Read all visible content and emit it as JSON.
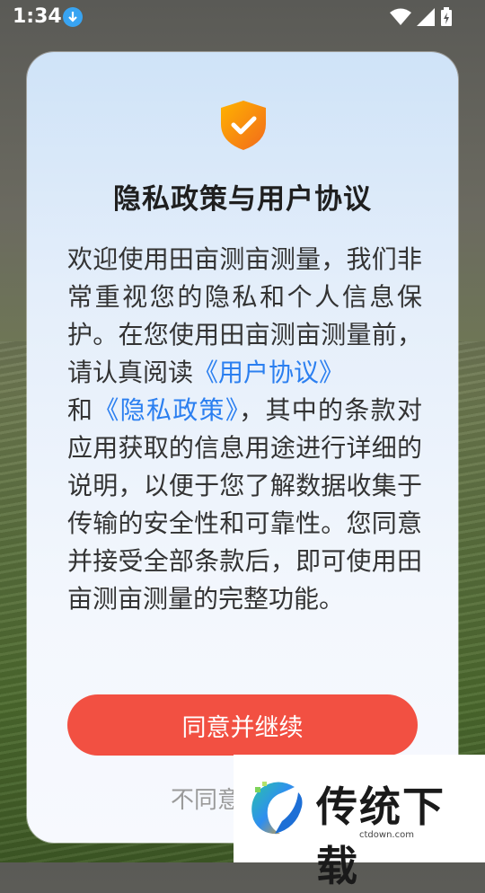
{
  "status_bar": {
    "time": "1:34",
    "download_icon": "download-arrow-icon",
    "wifi_icon": "wifi-icon",
    "signal_icon": "signal-icon",
    "battery_icon": "battery-charging-icon"
  },
  "dialog": {
    "shield_icon": "shield-check-icon",
    "title": "隐私政策与用户协议",
    "body_before": "欢迎使用田亩测亩测量，我们非常重视您的隐私和个人信息保护。在您使用田亩测亩测量前，请认真阅读",
    "link_user_agreement": "《用户协议》",
    "body_and": "和",
    "link_privacy_policy": "《隐私政策》",
    "body_after": "，其中的条款对应用获取的信息用途进行详细的说明，以便于您了解数据收集于传输的安全性和可靠性。您同意并接受全部条款后，即可使用田亩测亩测量的完整功能。",
    "agree_button": "同意并继续",
    "disagree_link": "不同意"
  },
  "watermark": {
    "brand": "传统下载",
    "site": "ctdown.com"
  },
  "colors": {
    "accent_button": "#f25042",
    "link": "#2b7ff0",
    "shield": "#f5a623"
  }
}
